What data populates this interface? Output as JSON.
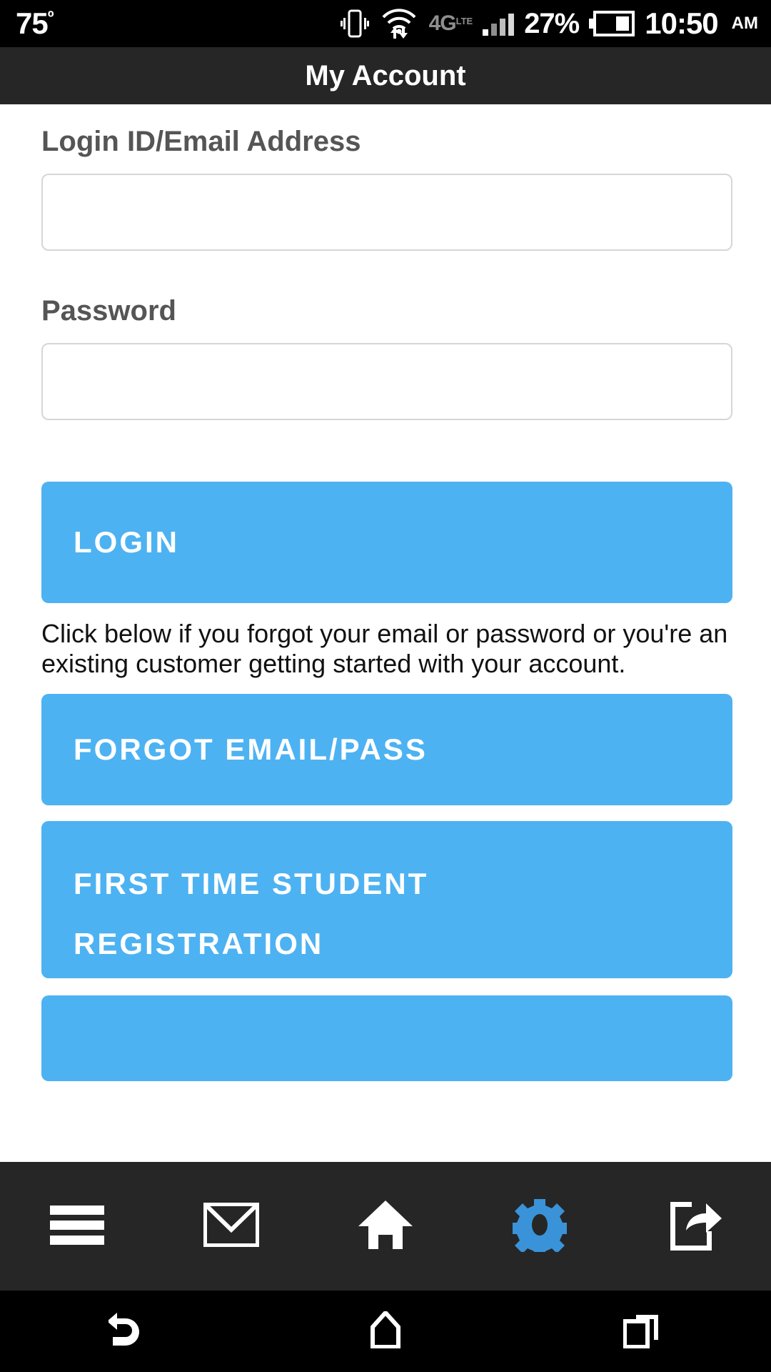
{
  "statusbar": {
    "temperature": "75",
    "degree_symbol": "º",
    "vibrate_icon": "vibrate-icon",
    "wifi_icon": "wifi-transfer-icon",
    "network_type": "4G",
    "network_suffix": "LTE",
    "signal_icon": "signal-bars-icon",
    "battery_percent": "27%",
    "battery_icon": "battery-icon",
    "time": "10:50",
    "ampm": "AM"
  },
  "titlebar": {
    "title": "My Account"
  },
  "form": {
    "login_label": "Login ID/Email Address",
    "login_value": "",
    "login_placeholder": "",
    "password_label": "Password",
    "password_value": "",
    "password_placeholder": ""
  },
  "buttons": {
    "login": "LOGIN",
    "forgot": "FORGOT EMAIL/PASS",
    "register_line1": "FIRST TIME STUDENT",
    "register_line2": "REGISTRATION",
    "partial": ""
  },
  "helper": {
    "text": "Click below if you forgot your email or password or you're an existing customer getting started with your account."
  },
  "appnav": {
    "items": [
      {
        "icon": "hamburger-menu-icon",
        "active": false
      },
      {
        "icon": "envelope-icon",
        "active": false
      },
      {
        "icon": "home-icon",
        "active": false
      },
      {
        "icon": "gear-icon",
        "active": true
      },
      {
        "icon": "share-icon",
        "active": false
      }
    ]
  },
  "sysnav": {
    "items": [
      {
        "icon": "back-icon"
      },
      {
        "icon": "home-icon"
      },
      {
        "icon": "recent-apps-icon"
      }
    ]
  },
  "colors": {
    "accent_blue": "#4DB2F2",
    "titlebar_dark": "#262626",
    "statusbar_black": "#000000",
    "label_gray": "#555555",
    "input_border": "#d6d6d6"
  }
}
